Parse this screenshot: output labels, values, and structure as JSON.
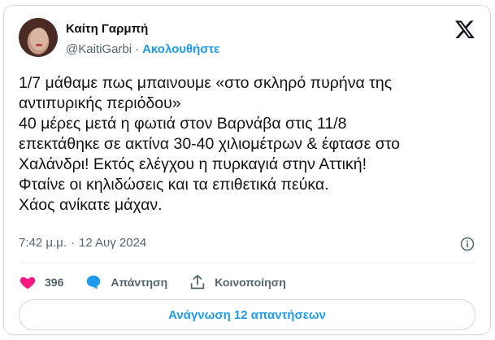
{
  "author": {
    "name": "Καίτη Γαρμπή",
    "handle": "@KaitiGarbi",
    "dot": "·",
    "follow_label": "Ακολουθήστε"
  },
  "tweet": {
    "lines": [
      "1/7 μάθαμε πως μπαινουμε «στο σκληρό πυρήνα της",
      "αντιπυρικής περιόδου»",
      "40 μέρες μετά η φωτιά στον Βαρνάβα στις 11/8",
      "επεκτάθηκε σε ακτίνα 30-40 χιλιομέτρων & έφτασε στο",
      "Χαλάνδρι! Εκτός ελέγχου η πυρκαγιά στην Αττική!",
      "Φταίνε οι κηλιδώσεις και τα επιθετικά πεύκα.",
      "Χάος ανίκατε μάχαν."
    ],
    "time": "7:42 μ.μ.",
    "sep": "·",
    "date": "12 Αυγ 2024"
  },
  "actions": {
    "likes": "396",
    "reply_label": "Απάντηση",
    "share_label": "Κοινοποίηση"
  },
  "read_replies_label": "Ανάγνωση 12 απαντήσεων",
  "colors": {
    "accent": "#1d9bf0",
    "like": "#f91880",
    "text": "#0f1419",
    "muted": "#536471"
  },
  "icons": [
    "x-logo-icon",
    "info-icon",
    "heart-icon",
    "reply-bubble-icon",
    "share-icon"
  ]
}
